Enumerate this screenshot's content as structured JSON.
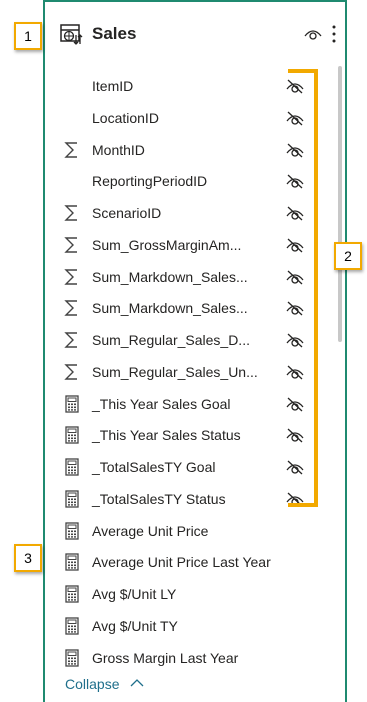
{
  "table": {
    "name": "Sales"
  },
  "fields": [
    {
      "label": "ItemID",
      "icon": "none",
      "hidden": true
    },
    {
      "label": "LocationID",
      "icon": "none",
      "hidden": true
    },
    {
      "label": "MonthID",
      "icon": "sigma-icon",
      "hidden": true
    },
    {
      "label": "ReportingPeriodID",
      "icon": "none",
      "hidden": true
    },
    {
      "label": "ScenarioID",
      "icon": "sigma-icon",
      "hidden": true
    },
    {
      "label": "Sum_GrossMarginAm...",
      "icon": "sigma-icon",
      "hidden": true
    },
    {
      "label": "Sum_Markdown_Sales...",
      "icon": "sigma-icon",
      "hidden": true
    },
    {
      "label": "Sum_Markdown_Sales...",
      "icon": "sigma-icon",
      "hidden": true
    },
    {
      "label": "Sum_Regular_Sales_D...",
      "icon": "sigma-icon",
      "hidden": true
    },
    {
      "label": "Sum_Regular_Sales_Un...",
      "icon": "sigma-icon",
      "hidden": true
    },
    {
      "label": "_This Year Sales Goal",
      "icon": "calculator-icon",
      "hidden": true
    },
    {
      "label": "_This Year Sales Status",
      "icon": "calculator-icon",
      "hidden": true
    },
    {
      "label": "_TotalSalesTY Goal",
      "icon": "calculator-icon",
      "hidden": true
    },
    {
      "label": "_TotalSalesTY Status",
      "icon": "calculator-icon",
      "hidden": true
    },
    {
      "label": "Average Unit Price",
      "icon": "calculator-icon",
      "hidden": false
    },
    {
      "label": "Average Unit Price Last Year",
      "icon": "calculator-icon",
      "hidden": false
    },
    {
      "label": "Avg $/Unit LY",
      "icon": "calculator-icon",
      "hidden": false
    },
    {
      "label": "Avg $/Unit TY",
      "icon": "calculator-icon",
      "hidden": false
    },
    {
      "label": "Gross Margin Last Year",
      "icon": "calculator-icon",
      "hidden": false
    }
  ],
  "collapse_label": "Collapse",
  "callouts": [
    "1",
    "2",
    "3"
  ],
  "colors": {
    "accent": "#1f8a70",
    "callout_border": "#f2a900",
    "link": "#1f6f8b"
  }
}
